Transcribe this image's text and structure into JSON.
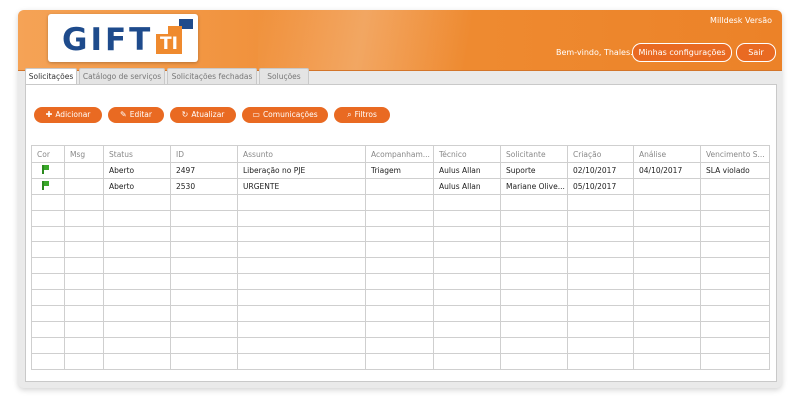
{
  "header": {
    "logo_text": "GIFT",
    "logo_suffix": "TI",
    "app_version": "Milldesk Versão",
    "welcome": "Bem-vindo, Thales.",
    "config_label": "Minhas configurações",
    "exit_label": "Sair",
    "accent_color": "#ee8a30",
    "logo_color": "#1e4b8c"
  },
  "tabs": [
    {
      "label": "Solicitações",
      "active": true
    },
    {
      "label": "Catálogo de serviços",
      "active": false
    },
    {
      "label": "Solicitações fechadas",
      "active": false
    },
    {
      "label": "Soluções",
      "active": false
    }
  ],
  "toolbar": {
    "add": {
      "label": "Adicionar",
      "icon": "plus-icon"
    },
    "edit": {
      "label": "Editar",
      "icon": "pencil-icon"
    },
    "refresh": {
      "label": "Atualizar",
      "icon": "refresh-icon"
    },
    "comm": {
      "label": "Comunicações",
      "icon": "chat-icon"
    },
    "filter": {
      "label": "Filtros",
      "icon": "search-icon"
    }
  },
  "table": {
    "columns": [
      "Cor",
      "Msg",
      "Status",
      "ID",
      "Assunto",
      "Acompanham...",
      "Técnico",
      "Solicitante",
      "Criação",
      "Análise",
      "Vencimento S..."
    ],
    "rows": [
      {
        "cor": "flag-green",
        "msg": "",
        "status": "Aberto",
        "id": "2497",
        "assunto": "Liberação no PJE",
        "acompanhamento": "Triagem",
        "tecnico": "Aulus Allan",
        "solicitante": "Suporte",
        "criacao": "02/10/2017",
        "analise": "04/10/2017",
        "vencimento": "SLA violado"
      },
      {
        "cor": "flag-green",
        "msg": "",
        "status": "Aberto",
        "id": "2530",
        "assunto": "URGENTE",
        "acompanhamento": "",
        "tecnico": "Aulus Allan",
        "solicitante": "Mariane Olive...",
        "criacao": "05/10/2017",
        "analise": "",
        "vencimento": ""
      }
    ]
  }
}
